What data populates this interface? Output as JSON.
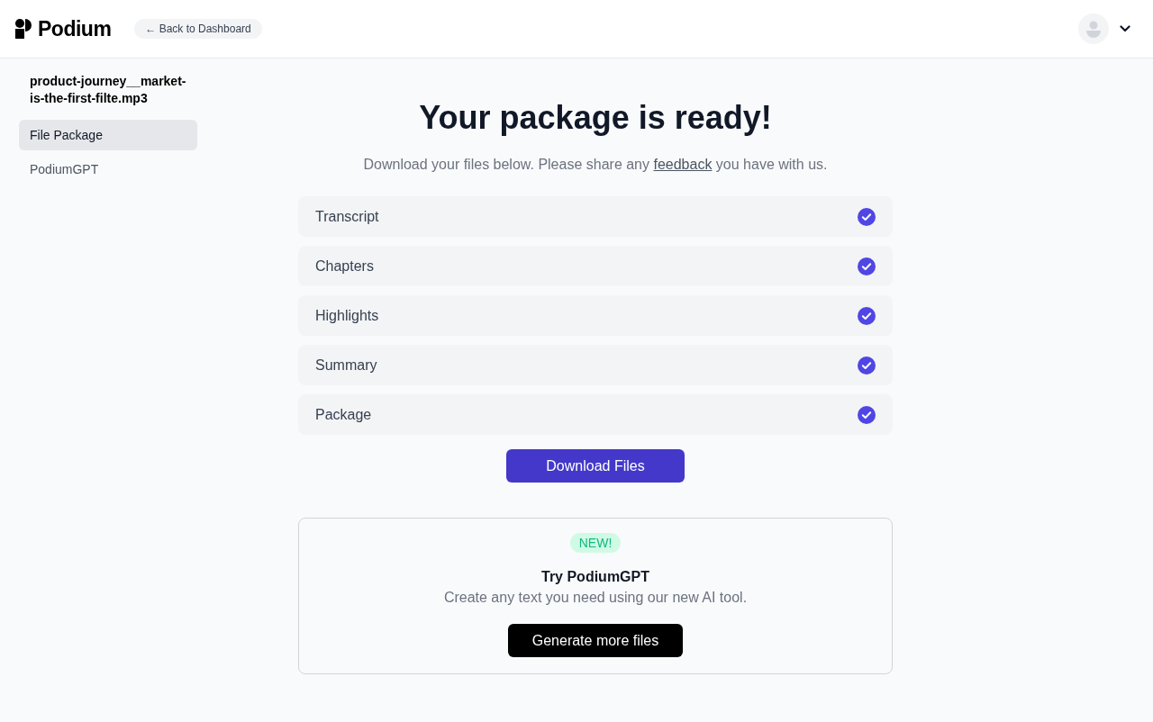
{
  "header": {
    "logo_text": "Podium",
    "back_button": "← Back to Dashboard"
  },
  "sidebar": {
    "file_name": "product-journey__market-is-the-first-filte.mp3",
    "items": [
      {
        "label": "File Package",
        "selected": true
      },
      {
        "label": "PodiumGPT",
        "selected": false
      }
    ]
  },
  "main": {
    "title": "Your package is ready!",
    "subtitle": {
      "before": "Download your files below. Please share any",
      "link": "feedback",
      "after": "you have with us."
    },
    "files": [
      {
        "label": "Transcript",
        "done": true
      },
      {
        "label": "Chapters",
        "done": true
      },
      {
        "label": "Highlights",
        "done": true
      },
      {
        "label": "Summary",
        "done": true
      },
      {
        "label": "Package",
        "done": true
      }
    ],
    "download_button": "Download Files"
  },
  "promo": {
    "badge": "NEW!",
    "title": "Try PodiumGPT",
    "description": "Create any text you need using our new AI tool.",
    "button": "Generate more files"
  }
}
